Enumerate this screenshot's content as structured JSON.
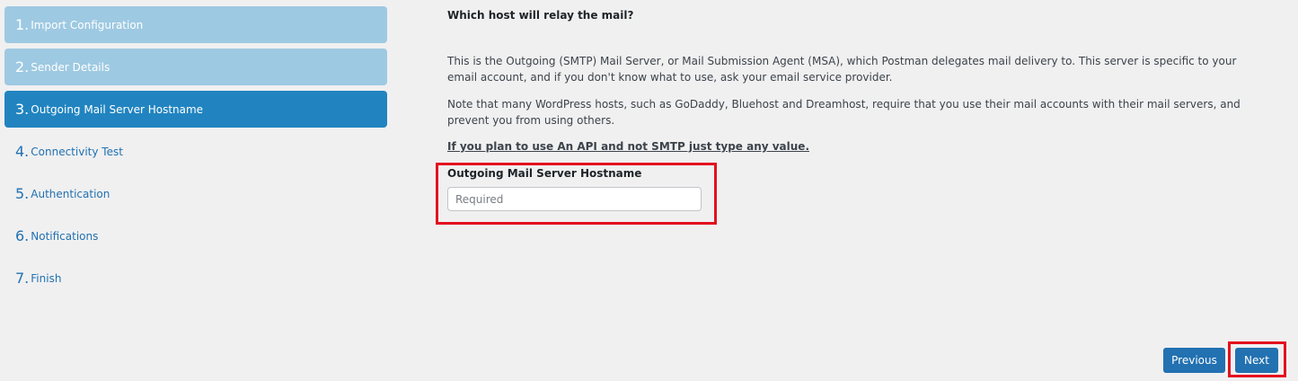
{
  "steps": [
    {
      "num": "1.",
      "label": "Import Configuration",
      "state": "done"
    },
    {
      "num": "2.",
      "label": "Sender Details",
      "state": "done"
    },
    {
      "num": "3.",
      "label": "Outgoing Mail Server Hostname",
      "state": "active"
    },
    {
      "num": "4.",
      "label": "Connectivity Test",
      "state": "pending"
    },
    {
      "num": "5.",
      "label": "Authentication",
      "state": "pending"
    },
    {
      "num": "6.",
      "label": "Notifications",
      "state": "pending"
    },
    {
      "num": "7.",
      "label": "Finish",
      "state": "pending"
    }
  ],
  "main": {
    "question": "Which host will relay the mail?",
    "para1": "This is the Outgoing (SMTP) Mail Server, or Mail Submission Agent (MSA), which Postman delegates mail delivery to. This server is specific to your email account, and if you don't know what to use, ask your email service provider.",
    "para2": "Note that many WordPress hosts, such as GoDaddy, Bluehost and Dreamhost, require that you use their mail accounts with their mail servers, and prevent you from using others.",
    "api_note": "If you plan to use An API and not SMTP just type any value.",
    "field_label": "Outgoing Mail Server Hostname",
    "field_value": "",
    "field_placeholder": "Required"
  },
  "buttons": {
    "previous": "Previous",
    "next": "Next"
  },
  "colors": {
    "step_done": "#9ec9e2",
    "step_active": "#2184c0",
    "link": "#2271b1",
    "highlight": "#e4101f",
    "button": "#2271b1"
  }
}
